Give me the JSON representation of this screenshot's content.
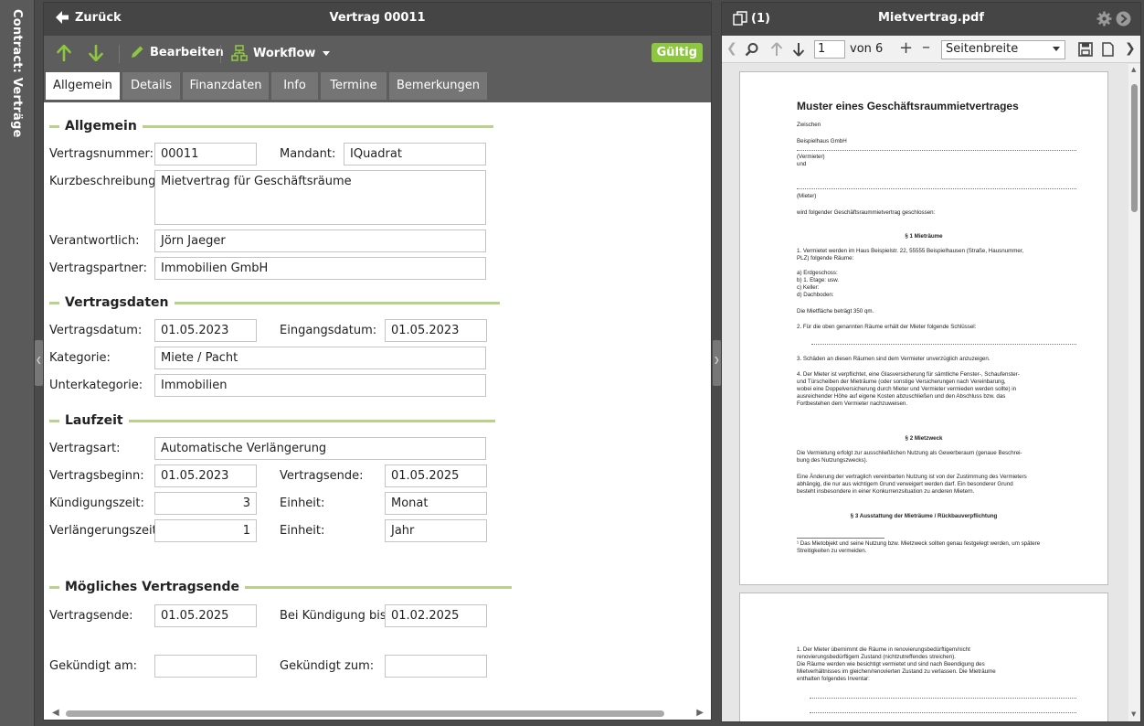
{
  "sidebar": {
    "label": "Contract: Verträge"
  },
  "main": {
    "back_label": "Zurück",
    "title": "Vertrag 00011",
    "toolbar": {
      "edit_label": "Bearbeiten",
      "workflow_label": "Workflow",
      "status_badge": "Gültig"
    },
    "tabs": [
      {
        "label": "Allgemein",
        "active": true
      },
      {
        "label": "Details"
      },
      {
        "label": "Finanzdaten"
      },
      {
        "label": "Info"
      },
      {
        "label": "Termine"
      },
      {
        "label": "Bemerkungen"
      }
    ],
    "sections": {
      "allgemein": "Allgemein",
      "vertragsdaten": "Vertragsdaten",
      "laufzeit": "Laufzeit",
      "ende": "Mögliches Vertragsende"
    },
    "labels": {
      "vertragsnummer": "Vertragsnummer:",
      "mandant": "Mandant:",
      "kurzbeschreibung": "Kurzbeschreibung:",
      "verantwortlich": "Verantwortlich:",
      "vertragspartner": "Vertragspartner:",
      "vertragsdatum": "Vertragsdatum:",
      "eingangsdatum": "Eingangsdatum:",
      "kategorie": "Kategorie:",
      "unterkategorie": "Unterkategorie:",
      "vertragsart": "Vertragsart:",
      "vertragsbeginn": "Vertragsbeginn:",
      "vertragsende": "Vertragsende:",
      "kuendigungszeit": "Kündigungszeit:",
      "einheit": "Einheit:",
      "verlaengerungszeit": "Verlängerungszeit:",
      "einheit2": "Einheit:",
      "vertragsende2": "Vertragsende:",
      "bei_kuendigung": "Bei Kündigung bis:",
      "gekuendigt_am": "Gekündigt am:",
      "gekuendigt_zum": "Gekündigt zum:"
    },
    "values": {
      "vertragsnummer": "00011",
      "mandant": "IQuadrat",
      "kurzbeschreibung": "Mietvertrag für Geschäftsräume",
      "verantwortlich": "Jörn Jaeger",
      "vertragspartner": "Immobilien GmbH",
      "vertragsdatum": "01.05.2023",
      "eingangsdatum": "01.05.2023",
      "kategorie": "Miete / Pacht",
      "unterkategorie": "Immobilien",
      "vertragsart": "Automatische Verlängerung",
      "vertragsbeginn": "01.05.2023",
      "vertragsende": "01.05.2025",
      "kuendigungszeit": "3",
      "einheit": "Monat",
      "verlaengerungszeit": "1",
      "einheit2": "Jahr",
      "vertragsende2": "01.05.2025",
      "bei_kuendigung": "01.02.2025",
      "gekuendigt_am": "",
      "gekuendigt_zum": ""
    }
  },
  "pdf": {
    "attachment_count": "(1)",
    "filename": "Mietvertrag.pdf",
    "page_value": "1",
    "page_of": "von 6",
    "zoom_value": "Seitenbreite",
    "page1": {
      "title": "Muster eines Geschäftsraummietvertrages",
      "l1": "Zwischen",
      "l2": "Beispielhaus GmbH",
      "l3": "(Vermieter)",
      "l4": "und",
      "l5": "(Mieter)",
      "l6": "wird folgender Geschäftsraummietvertrag geschlossen:",
      "h1": "§ 1 Mieträume",
      "p1a": "1.     Vermietet werden im Haus Beispielstr. 22, 55555 Beispielhausen (Straße, Hausnummer,",
      "p1b": "        PLZ) folgende Räume:",
      "p1c": "        a) Erdgeschoss:",
      "p1d": "        b) 1. Etage:                                   usw.",
      "p1e": "        c) Keller:",
      "p1f": "        d) Dachboden:",
      "p1g": "        Die Mietfläche beträgt 350 qm.",
      "p2": "2.     Für die oben genannten Räume erhält der Mieter folgende Schlüssel:",
      "p3": "3.     Schäden an diesen Räumen sind dem Vermieter unverzüglich anzuzeigen.",
      "p4a": "4.     Der Mieter ist verpflichtet, eine Glasversicherung für sämtliche Fenster-, Schaufenster-",
      "p4b": "        und Türscheiben der Mieträume (oder sonstige Versicherungen nach Vereinbarung,",
      "p4c": "        wobei eine Doppelversicherung durch Mieter und Vermieter vermieden werden sollte) in",
      "p4d": "        ausreichender Höhe auf eigene Kosten abzuschließen und den Abschluss bzw. das",
      "p4e": "        Fortbestehen dem Vermieter nachzuweisen.",
      "h2": "§ 2 Mietzweck",
      "q1a": "Die Vermietung erfolgt zur ausschließlichen Nutzung als Gewerberaum (genaue Beschrei-",
      "q1b": "bung des Nutzungszwecks).",
      "q2a": "Eine Änderung der vertraglich vereinbarten Nutzung ist von der Zustimmung des Vermieters",
      "q2b": "abhängig, die nur aus wichtigem Grund verweigert werden darf. Ein besonderer Grund",
      "q2c": "besteht insbesondere in einer Konkurrenzsituation zu anderen Mietern.",
      "h3": "§ 3 Ausstattung der Mieträume / Rückbauverpflichtung",
      "fn1": "¹ Das Mietobjekt und seine Nutzung bzw. Mietzweck sollten genau festgelegt werden, um spätere",
      "fn2": "   Streitigkeiten zu vermeiden."
    },
    "page2": {
      "a": "1.     Der     Mieter     übernimmt     die     Räume     in     renovierungsbedürftigem/nicht",
      "b": "        renovierungsbedürftigem Zustand (nichtzutreffendes streichen).",
      "c": "        Die   Räume   werden   wie   besichtigt   vermietet   und   sind   nach   Beendigung   des",
      "d": "        Mietverhältnisses im gleichen/renovierten Zustand zu verlassen. Die Mieträume",
      "e": "        enthalten folgendes Inventar:"
    }
  }
}
